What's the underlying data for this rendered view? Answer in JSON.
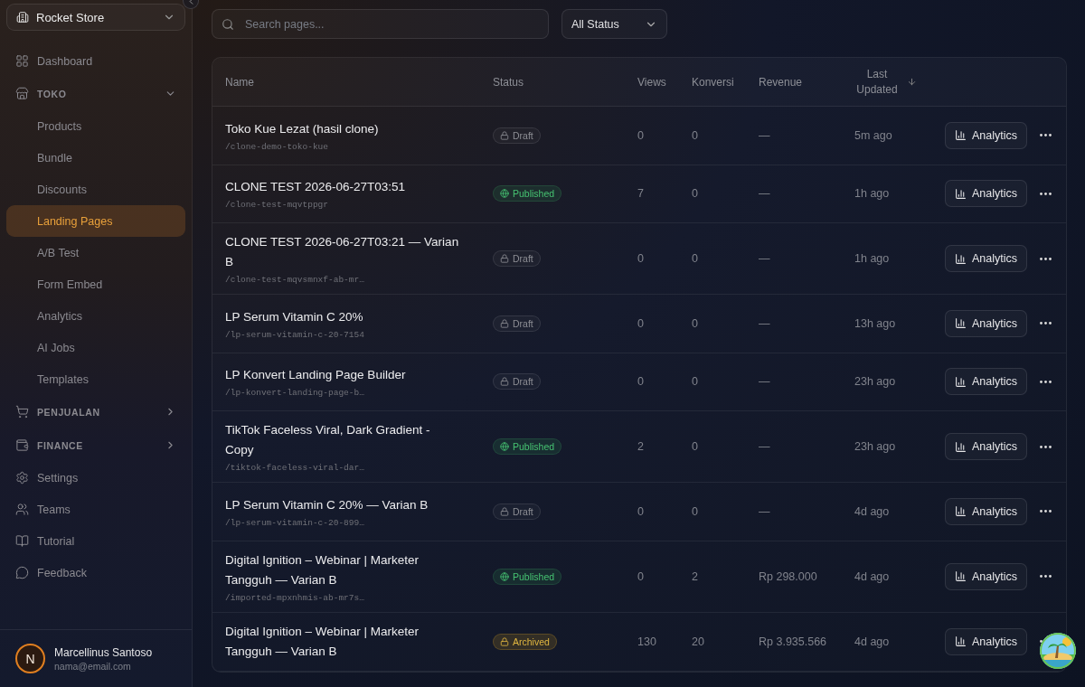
{
  "sidebar": {
    "store": {
      "name": "Rocket Store"
    },
    "items": [
      {
        "kind": "link",
        "label": "Dashboard",
        "selected": false
      },
      {
        "kind": "section",
        "label": "TOKO",
        "expanded": true,
        "children": [
          {
            "label": "Products",
            "selected": false
          },
          {
            "label": "Bundle",
            "selected": false
          },
          {
            "label": "Discounts",
            "selected": false
          },
          {
            "label": "Landing Pages",
            "selected": true
          },
          {
            "label": "A/B Test",
            "selected": false
          },
          {
            "label": "Form Embed",
            "selected": false
          },
          {
            "label": "Analytics",
            "selected": false
          },
          {
            "label": "AI Jobs",
            "selected": false
          },
          {
            "label": "Templates",
            "selected": false
          }
        ]
      },
      {
        "kind": "section",
        "label": "PENJUALAN",
        "expanded": false
      },
      {
        "kind": "section",
        "label": "FINANCE",
        "expanded": false
      },
      {
        "kind": "link",
        "label": "Settings",
        "selected": false
      },
      {
        "kind": "link",
        "label": "Teams",
        "selected": false
      },
      {
        "kind": "link",
        "label": "Tutorial",
        "selected": false
      },
      {
        "kind": "link",
        "label": "Feedback",
        "selected": false
      }
    ],
    "user": {
      "initial": "N",
      "name": "Marcellinus Santoso",
      "email": "nama@email.com"
    }
  },
  "toolbar": {
    "search": {
      "placeholder": "Search pages..."
    },
    "status_filter": {
      "value": "All Status"
    }
  },
  "table": {
    "columns": [
      "Name",
      "Status",
      "Views",
      "Konversi",
      "Revenue",
      "Last Updated"
    ],
    "rows": [
      {
        "name": "Toko Kue Lezat (hasil clone)",
        "slug": "/clone-demo-toko-kue",
        "status": {
          "kind": "draft",
          "label": "Draft"
        },
        "views": "0",
        "konversi": "0",
        "revenue": "—",
        "updated": "5m ago",
        "action": "Analytics"
      },
      {
        "name": "CLONE TEST 2026-06-27T03:51",
        "slug": "/clone-test-mqvtppgr",
        "status": {
          "kind": "published",
          "label": "Published"
        },
        "views": "7",
        "konversi": "0",
        "revenue": "—",
        "updated": "1h ago",
        "action": "Analytics"
      },
      {
        "name": "CLONE TEST 2026-06-27T03:21 — Varian B",
        "slug": "/clone-test-mqvsmnxf-ab-mr…",
        "status": {
          "kind": "draft",
          "label": "Draft"
        },
        "views": "0",
        "konversi": "0",
        "revenue": "—",
        "updated": "1h ago",
        "action": "Analytics"
      },
      {
        "name": "LP Serum Vitamin C 20%",
        "slug": "/lp-serum-vitamin-c-20-7154",
        "status": {
          "kind": "draft",
          "label": "Draft"
        },
        "views": "0",
        "konversi": "0",
        "revenue": "—",
        "updated": "13h ago",
        "action": "Analytics"
      },
      {
        "name": "LP Konvert Landing Page Builder",
        "slug": "/lp-konvert-landing-page-b…",
        "status": {
          "kind": "draft",
          "label": "Draft"
        },
        "views": "0",
        "konversi": "0",
        "revenue": "—",
        "updated": "23h ago",
        "action": "Analytics"
      },
      {
        "name": "TikTok Faceless Viral, Dark Gradient - Copy",
        "slug": "/tiktok-faceless-viral-dar…",
        "status": {
          "kind": "published",
          "label": "Published"
        },
        "views": "2",
        "konversi": "0",
        "revenue": "—",
        "updated": "23h ago",
        "action": "Analytics"
      },
      {
        "name": "LP Serum Vitamin C 20% — Varian B",
        "slug": "/lp-serum-vitamin-c-20-899…",
        "status": {
          "kind": "draft",
          "label": "Draft"
        },
        "views": "0",
        "konversi": "0",
        "revenue": "—",
        "updated": "4d ago",
        "action": "Analytics"
      },
      {
        "name": "Digital Ignition – Webinar | Marketer Tangguh — Varian B",
        "slug": "/imported-mpxnhmis-ab-mr7s…",
        "status": {
          "kind": "published",
          "label": "Published"
        },
        "views": "0",
        "konversi": "2",
        "revenue": "Rp 298.000",
        "updated": "4d ago",
        "action": "Analytics"
      },
      {
        "name": "Digital Ignition – Webinar | Marketer Tangguh — Varian B",
        "status": {
          "kind": "archived",
          "label": "Archived"
        },
        "views": "130",
        "konversi": "20",
        "revenue": "Rp 3.935.566",
        "updated": "4d ago",
        "action": "Analytics"
      }
    ]
  }
}
